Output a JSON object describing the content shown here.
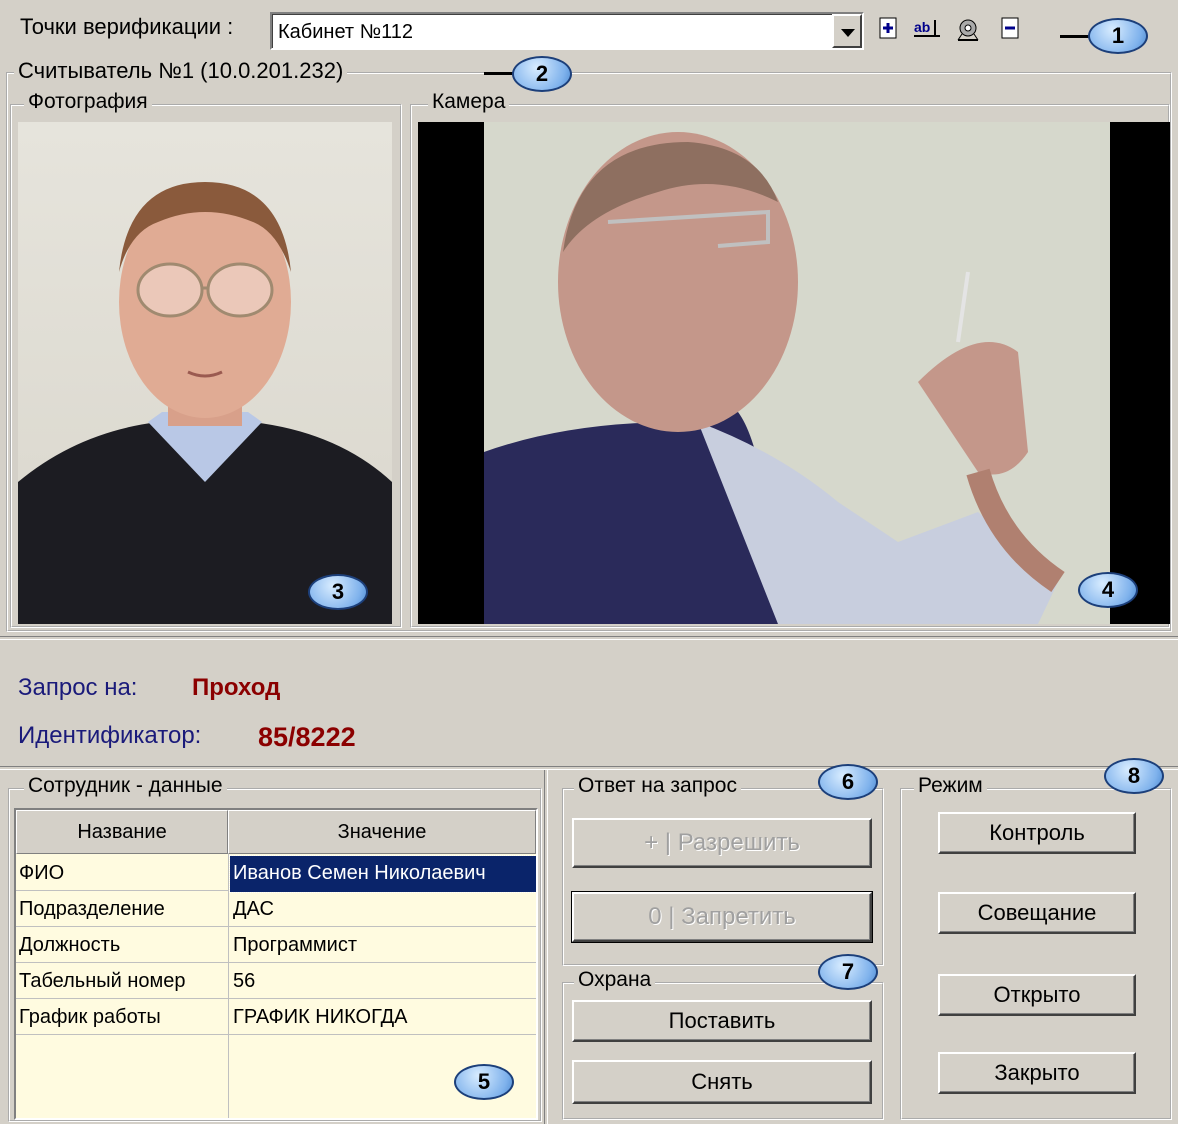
{
  "toolbar": {
    "points_label": "Точки верификации :",
    "points_value": "Кабинет №112",
    "icons": [
      "add-point-icon",
      "rename-icon",
      "settings-icon",
      "remove-point-icon"
    ],
    "btn_add": "+",
    "btn_rename": "ab|",
    "btn_settings": "⚙",
    "btn_remove": "−"
  },
  "reader": {
    "title": "Считыватель №1 (10.0.201.232)"
  },
  "photo": {
    "title": "Фотография"
  },
  "camera": {
    "title": "Камера"
  },
  "request": {
    "label_for": "Запрос на:",
    "value_for": "Проход",
    "label_id": "Идентификатор:",
    "value_id": "85/8222"
  },
  "employee": {
    "title": "Сотрудник - данные",
    "columns": [
      "Название",
      "Значение"
    ],
    "rows": [
      {
        "name": "ФИО",
        "value": "Иванов Семен Николаевич"
      },
      {
        "name": "Подразделение",
        "value": "ДАС"
      },
      {
        "name": "Должность",
        "value": "Программист"
      },
      {
        "name": "Табельный номер",
        "value": "56"
      },
      {
        "name": "График работы",
        "value": "ГРАФИК НИКОГДА"
      }
    ]
  },
  "answer": {
    "title": "Ответ на запрос",
    "allow": "+ | Разрешить",
    "deny": "0 | Запретить"
  },
  "guard": {
    "title": "Охрана",
    "arm": "Поставить",
    "disarm": "Снять"
  },
  "mode": {
    "title": "Режим",
    "control": "Контроль",
    "meeting": "Совещание",
    "open": "Открыто",
    "closed": "Закрыто"
  },
  "callouts": [
    "1",
    "2",
    "3",
    "4",
    "5",
    "6",
    "7",
    "8"
  ]
}
